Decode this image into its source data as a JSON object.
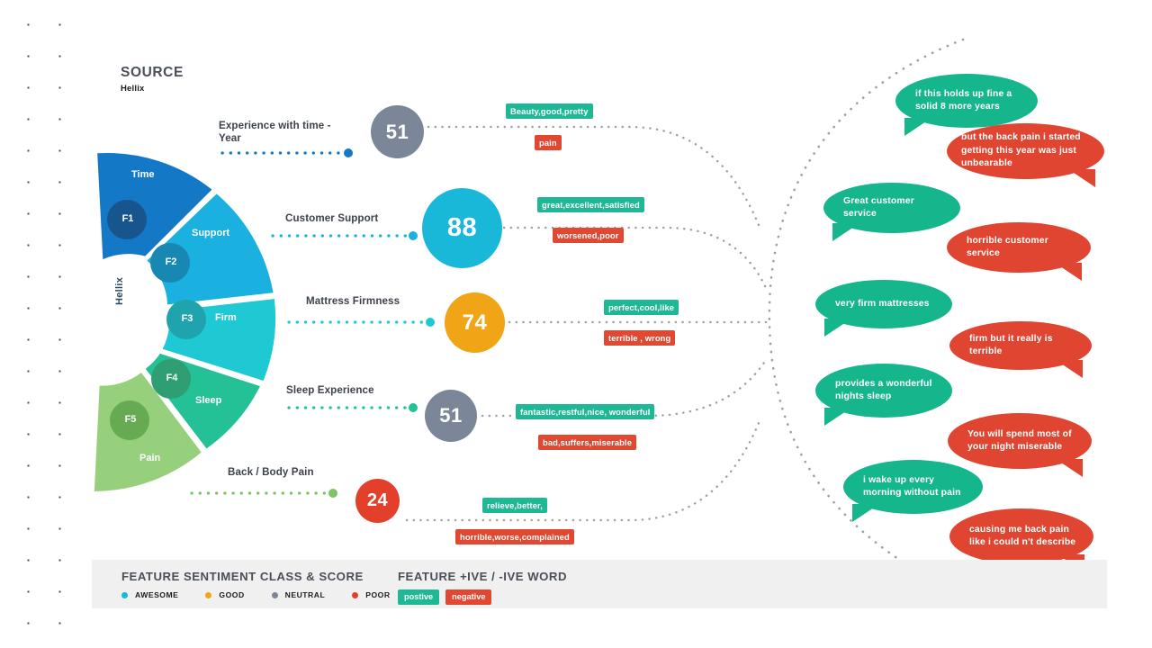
{
  "source": {
    "title": "SOURCE",
    "name": "Hellix"
  },
  "brand_vertical": "Hellix",
  "wheel": {
    "segments": [
      {
        "code": "F1",
        "label": "Time",
        "color": "#1379c6",
        "node_color": "#17558f"
      },
      {
        "code": "F2",
        "label": "Support",
        "color": "#1ab0e0",
        "node_color": "#1888b3"
      },
      {
        "code": "F3",
        "label": "Firm",
        "color": "#1fc9d4",
        "node_color": "#1fa3ac"
      },
      {
        "code": "F4",
        "label": "Sleep",
        "color": "#23c195",
        "node_color": "#2f9e72"
      },
      {
        "code": "F5",
        "label": "Pain",
        "color": "#97d07c",
        "node_color": "#5ba košiče"
      }
    ]
  },
  "features": [
    {
      "code": "F1",
      "name": "Experience with time -\nYear",
      "name_line1": "Experience with time -",
      "name_line2": "Year",
      "score": "51",
      "score_class": "NEUTRAL",
      "score_color": "#7b8799",
      "connector_color": "#1379c6",
      "positive_words": "Beauty,good,pretty",
      "negative_words": "pain"
    },
    {
      "code": "F2",
      "name": "Customer Support",
      "name_line1": "Customer Support",
      "name_line2": "",
      "score": "88",
      "score_class": "AWESOME",
      "score_color": "#1ab8d8",
      "connector_color": "#1ab0e0",
      "positive_words": "great,excellent,satisfied",
      "negative_words": "worsened,poor"
    },
    {
      "code": "F3",
      "name": "Mattress Firmness",
      "name_line1": "Mattress Firmness",
      "name_line2": "",
      "score": "74",
      "score_class": "GOOD",
      "score_color": "#efa516",
      "connector_color": "#1fc9d4",
      "positive_words": "perfect,cool,like",
      "negative_words": "terrible , wrong"
    },
    {
      "code": "F4",
      "name": "Sleep Experience",
      "name_line1": "Sleep Experience",
      "name_line2": "",
      "score": "51",
      "score_class": "NEUTRAL",
      "score_color": "#7b8799",
      "connector_color": "#23c195",
      "positive_words": "fantastic,restful,nice, wonderful",
      "negative_words": "bad,suffers,miserable"
    },
    {
      "code": "F5",
      "name": "Back / Body Pain",
      "name_line1": "Back / Body Pain",
      "name_line2": "",
      "score": "24",
      "score_class": "POOR",
      "score_color": "#e3402c",
      "connector_color": "#7fc268",
      "positive_words": "relieve,better,",
      "negative_words": "horrible,worse,complained"
    }
  ],
  "quotes": [
    {
      "sentiment": "positive",
      "text": "if this holds up fine a solid 8 more years"
    },
    {
      "sentiment": "negative",
      "text": "but the back pain i started getting this year was just unbearable"
    },
    {
      "sentiment": "positive",
      "text": "Great customer service"
    },
    {
      "sentiment": "negative",
      "text": "horrible customer service"
    },
    {
      "sentiment": "positive",
      "text": "very firm mattresses"
    },
    {
      "sentiment": "negative",
      "text": "firm but it really is terrible"
    },
    {
      "sentiment": "positive",
      "text": "provides a wonderful nights sleep"
    },
    {
      "sentiment": "negative",
      "text": "You will spend most of your night miserable"
    },
    {
      "sentiment": "positive",
      "text": "i wake up every morning without pain"
    },
    {
      "sentiment": "negative",
      "text": "causing me back pain like i could n't describe"
    }
  ],
  "legend": {
    "class_heading": "FEATURE SENTIMENT CLASS & SCORE",
    "classes": [
      {
        "label": "AWESOME",
        "color": "#1ab8d8"
      },
      {
        "label": "GOOD",
        "color": "#efa516"
      },
      {
        "label": "NEUTRAL",
        "color": "#7b8799"
      },
      {
        "label": "POOR",
        "color": "#e3402c"
      }
    ],
    "word_heading": "FEATURE +IVE / -IVE WORD",
    "word_chips": [
      {
        "label": "postive",
        "color": "#1fb894"
      },
      {
        "label": "negative",
        "color": "#e04832"
      }
    ]
  }
}
